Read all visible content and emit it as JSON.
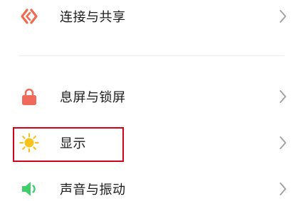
{
  "settings": {
    "items": [
      {
        "label": "连接与共享",
        "icon": "connection-share-icon",
        "icon_color": "#f06a4f"
      },
      {
        "label": "息屏与锁屏",
        "icon": "lock-icon",
        "icon_color": "#ef6a5a"
      },
      {
        "label": "显示",
        "icon": "sun-icon",
        "icon_color": "#f7c21a",
        "highlighted": true
      },
      {
        "label": "声音与振动",
        "icon": "speaker-icon",
        "icon_color": "#3ecf6b"
      }
    ]
  },
  "colors": {
    "text": "#1b1b1b",
    "chevron": "#a3a3a3",
    "divider": "#ececec",
    "highlight": "#d0021b"
  }
}
